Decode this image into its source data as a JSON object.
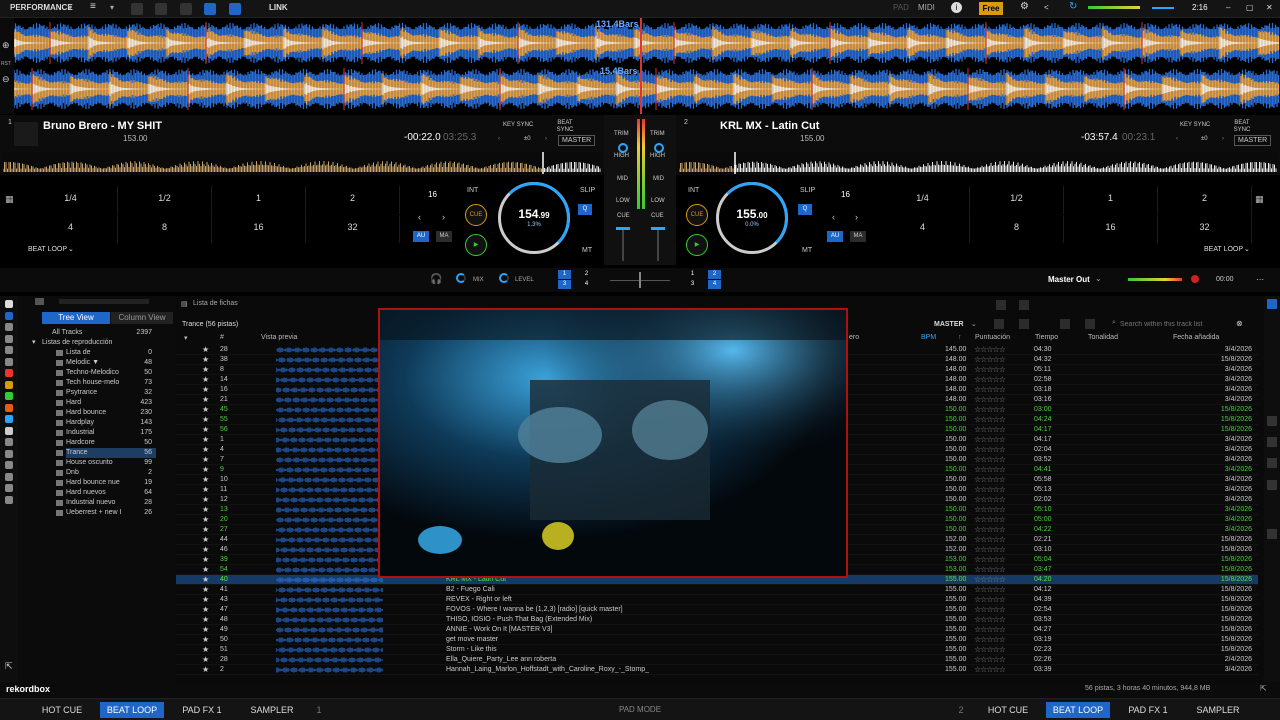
{
  "topbar": {
    "mode": "PERFORMANCE",
    "link": "LINK",
    "pad": "PAD",
    "midi": "MIDI",
    "plan": "Free",
    "clock": "2:16"
  },
  "waveform": {
    "deck1_bars": "131.4Bars",
    "deck2_bars": "15.4Bars",
    "rst": "RST"
  },
  "deck1": {
    "num": "1",
    "title": "Bruno Brero - MY SHIT",
    "bpm": "153.00",
    "time_elapsed": "-00:22.0",
    "time_total": "03:25.3",
    "key_sync": "KEY SYNC",
    "beat_sync": "BEAT SYNC",
    "pm": "±0",
    "master": "MASTER",
    "beatloop_label": "BEAT LOOP",
    "pads": [
      "1/4",
      "1/2",
      "1",
      "2",
      "4",
      "8",
      "16",
      "32"
    ],
    "loop_len": "16",
    "int": "INT",
    "cue": "CUE",
    "jog_bpm": "154",
    "jog_bpm_dec": ".99",
    "jog_pitch": "1.3%",
    "slip": "SLIP",
    "q": "Q",
    "au": "AU",
    "ma": "MA",
    "mt": "MT"
  },
  "deck2": {
    "num": "2",
    "title": "KRL MX - Latin Cut",
    "bpm": "155.00",
    "time_elapsed": "-03:57.4",
    "time_total": "00:23.1",
    "key_sync": "KEY SYNC",
    "beat_sync": "BEAT SYNC",
    "pm": "±0",
    "master": "MASTER",
    "beatloop_label": "BEAT LOOP",
    "pads": [
      "1/4",
      "1/2",
      "1",
      "2",
      "4",
      "8",
      "16",
      "32"
    ],
    "loop_len": "16",
    "int": "INT",
    "cue": "CUE",
    "jog_bpm": "155",
    "jog_bpm_dec": ".00",
    "jog_pitch": "0.0%",
    "slip": "SLIP",
    "q": "Q",
    "au": "AU",
    "ma": "MA",
    "mt": "MT"
  },
  "mixer": {
    "trim": "TRIM",
    "high": "HIGH",
    "mid": "MID",
    "low": "LOW",
    "cue": "CUE",
    "mix": "MIX",
    "level": "LEVEL",
    "master_out": "Master Out",
    "time": "00:00",
    "fx_ch_left": [
      "1",
      "2",
      "3",
      "4"
    ],
    "fx_ch_right": [
      "1",
      "2",
      "3",
      "4"
    ]
  },
  "browser": {
    "playlist_header": "Lista de fichas",
    "tree_view": "Tree View",
    "column_view": "Column View",
    "list_title": "Trance (56 pistas)",
    "master": "MASTER",
    "search_placeholder": "Search within this track list",
    "tree": [
      {
        "label": "All Tracks",
        "count": "2397"
      },
      {
        "label": "Listas de reproducción",
        "count": ""
      },
      {
        "label": "Lista de",
        "count": "0"
      },
      {
        "label": "Melodic ▼",
        "count": "48"
      },
      {
        "label": "Techno-Melodico",
        "count": "50"
      },
      {
        "label": "Tech house-melo",
        "count": "73"
      },
      {
        "label": "Psytrance",
        "count": "32"
      },
      {
        "label": "Hard",
        "count": "423"
      },
      {
        "label": "Hard bounce",
        "count": "230"
      },
      {
        "label": "Hardplay",
        "count": "143"
      },
      {
        "label": "Industrial",
        "count": "175"
      },
      {
        "label": "Hardcore",
        "count": "50"
      },
      {
        "label": "Trance",
        "count": "56"
      },
      {
        "label": "House oscurito",
        "count": "99"
      },
      {
        "label": "Dnb",
        "count": "2"
      },
      {
        "label": "Hard bounce nue",
        "count": "19"
      },
      {
        "label": "Hard nuevos",
        "count": "64"
      },
      {
        "label": "Industrial nuevo",
        "count": "28"
      },
      {
        "label": "Ueberrest + new I",
        "count": "26"
      }
    ],
    "columns": {
      "num": "#",
      "preview": "Vista previa",
      "genre": "ero",
      "bpm": "BPM",
      "rating": "Puntuación",
      "time": "Tiempo",
      "key": "Tonalidad",
      "date": "Fecha añadida"
    },
    "rows": [
      {
        "n": "28",
        "title": "",
        "bpm": "145.00",
        "time": "04:30",
        "date": "3/4/2026",
        "g": false
      },
      {
        "n": "38",
        "title": "",
        "bpm": "148.00",
        "time": "04:32",
        "date": "15/8/2026",
        "g": false
      },
      {
        "n": "8",
        "title": "",
        "bpm": "148.00",
        "time": "05:11",
        "date": "3/4/2026",
        "g": false
      },
      {
        "n": "14",
        "title": "",
        "bpm": "148.00",
        "time": "02:58",
        "date": "3/4/2026",
        "g": false
      },
      {
        "n": "16",
        "title": "",
        "bpm": "148.00",
        "time": "03:18",
        "date": "3/4/2026",
        "g": false
      },
      {
        "n": "21",
        "title": "",
        "bpm": "148.00",
        "time": "03:16",
        "date": "3/4/2026",
        "g": false
      },
      {
        "n": "45",
        "title": "",
        "bpm": "150.00",
        "time": "03:00",
        "date": "15/8/2026",
        "g": true
      },
      {
        "n": "55",
        "title": "",
        "bpm": "150.00",
        "time": "04:24",
        "date": "15/8/2026",
        "g": true
      },
      {
        "n": "56",
        "title": "",
        "bpm": "150.00",
        "time": "04:17",
        "date": "15/8/2026",
        "g": true
      },
      {
        "n": "1",
        "title": "",
        "bpm": "150.00",
        "time": "04:17",
        "date": "3/4/2026",
        "g": false
      },
      {
        "n": "4",
        "title": "",
        "bpm": "150.00",
        "time": "02:04",
        "date": "3/4/2026",
        "g": false
      },
      {
        "n": "7",
        "title": "",
        "bpm": "150.00",
        "time": "03:52",
        "date": "3/4/2026",
        "g": false
      },
      {
        "n": "9",
        "title": "",
        "bpm": "150.00",
        "time": "04:41",
        "date": "3/4/2026",
        "g": true
      },
      {
        "n": "10",
        "title": "",
        "bpm": "150.00",
        "time": "05:58",
        "date": "3/4/2026",
        "g": false
      },
      {
        "n": "11",
        "title": "",
        "bpm": "150.00",
        "time": "05:13",
        "date": "3/4/2026",
        "g": false
      },
      {
        "n": "12",
        "title": "",
        "bpm": "150.00",
        "time": "02:02",
        "date": "3/4/2026",
        "g": false
      },
      {
        "n": "13",
        "title": "",
        "bpm": "150.00",
        "time": "05:10",
        "date": "3/4/2026",
        "g": true
      },
      {
        "n": "20",
        "title": "",
        "bpm": "150.00",
        "time": "05:00",
        "date": "3/4/2026",
        "g": true
      },
      {
        "n": "27",
        "title": "",
        "bpm": "150.00",
        "time": "04:22",
        "date": "3/4/2026",
        "g": true
      },
      {
        "n": "44",
        "title": "",
        "bpm": "152.00",
        "time": "02:21",
        "date": "15/8/2026",
        "g": false
      },
      {
        "n": "46",
        "title": "",
        "bpm": "152.00",
        "time": "03:10",
        "date": "15/8/2026",
        "g": false
      },
      {
        "n": "39",
        "title": "",
        "bpm": "153.00",
        "time": "05:04",
        "date": "15/8/2026",
        "g": true
      },
      {
        "n": "54",
        "title": "",
        "bpm": "153.00",
        "time": "03:47",
        "date": "15/8/2026",
        "g": true
      },
      {
        "n": "40",
        "title": "KRL MX - Latin Cut",
        "bpm": "155.00",
        "time": "04:20",
        "date": "15/8/2026",
        "g": true,
        "sel": true
      },
      {
        "n": "41",
        "title": "B2 - Fuego Cali",
        "bpm": "155.00",
        "time": "04:12",
        "date": "15/8/2026",
        "g": false
      },
      {
        "n": "43",
        "title": "REVEX - Right or left",
        "bpm": "155.00",
        "time": "04:39",
        "date": "15/8/2026",
        "g": false
      },
      {
        "n": "47",
        "title": "FOVOS - Where I wanna be (1,2,3) [radio] [quick master]",
        "bpm": "155.00",
        "time": "02:54",
        "date": "15/8/2026",
        "g": false
      },
      {
        "n": "48",
        "title": "THISO, IOSIO - Push That Bag (Extended Mix)",
        "bpm": "155.00",
        "time": "03:53",
        "date": "15/8/2026",
        "g": false
      },
      {
        "n": "49",
        "title": "ANNIE - Work On It [MASTER V3]",
        "bpm": "155.00",
        "time": "04:27",
        "date": "15/8/2026",
        "g": false
      },
      {
        "n": "50",
        "title": "get move master",
        "bpm": "155.00",
        "time": "03:19",
        "date": "15/8/2026",
        "g": false
      },
      {
        "n": "51",
        "title": "Storm - Like this",
        "bpm": "155.00",
        "time": "02:23",
        "date": "15/8/2026",
        "g": false
      },
      {
        "n": "28",
        "title": "Ella_Quiere_Party_Lee ann roberta",
        "bpm": "155.00",
        "time": "02:26",
        "date": "2/4/2026",
        "g": false
      },
      {
        "n": "2",
        "title": "Hannah_Laing_Marlon_Hoffstadt_with_Caroline_Roxy_-_Stomp_",
        "bpm": "155.00",
        "time": "03:39",
        "date": "3/4/2026",
        "g": false
      }
    ],
    "footer": "56 pistas, 3 horas 40 minutos, 944,8 MB"
  },
  "bottombar": {
    "logo": "rekordbox",
    "left": [
      "HOT CUE",
      "BEAT LOOP",
      "PAD FX 1",
      "SAMPLER"
    ],
    "left_num": "1",
    "pad_mode": "PAD MODE",
    "right_num": "2",
    "right": [
      "HOT CUE",
      "BEAT LOOP",
      "PAD FX 1",
      "SAMPLER"
    ]
  },
  "colors": {
    "accent": "#1e66c8",
    "wave_blue": "#2a6fd8",
    "wave_orange": "#e8a040",
    "green": "#4fcf3f",
    "video_border": "#b01010"
  }
}
